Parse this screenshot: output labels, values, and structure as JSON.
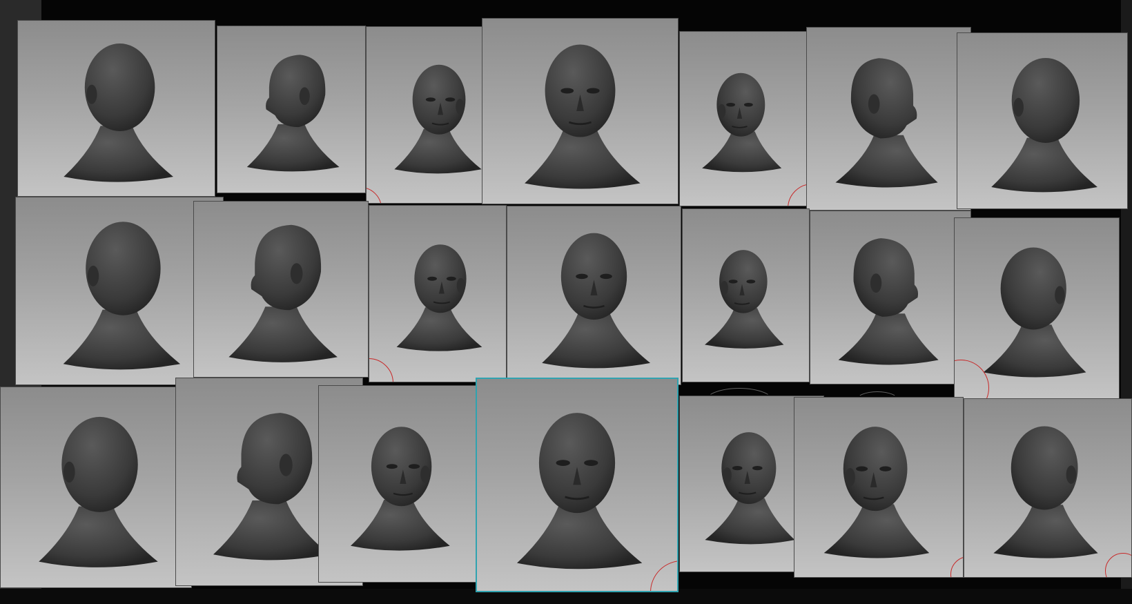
{
  "gallery": {
    "description_icon": "head-sculpt-icon",
    "selected_tile": "tile-r3-c4",
    "colors": {
      "background": "#050505",
      "tile_top": "#8c8c8c",
      "tile_bottom": "#c4c4c4",
      "sculpt": "#3a3a3a",
      "selection": "#2fa3b0",
      "gizmo": "#c82828"
    },
    "rows": [
      {
        "views": [
          "back-left",
          "left-profile",
          "three-quarter-up-left",
          "front-up",
          "three-quarter-up-right",
          "right-profile",
          "back"
        ]
      },
      {
        "views": [
          "back-left",
          "left-profile",
          "three-quarter-left",
          "front",
          "three-quarter-right",
          "right-profile",
          "back-right"
        ]
      },
      {
        "views": [
          "back-left-down",
          "left-profile-down",
          "three-quarter-down-left",
          "front-down",
          "three-quarter-down-right",
          "right-three-quarter-down",
          "back-right-down"
        ]
      }
    ]
  }
}
